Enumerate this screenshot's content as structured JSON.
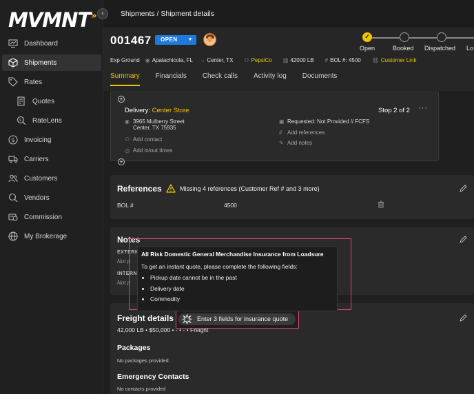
{
  "app": {
    "logo": "MVMNT",
    "logo_accent": "»",
    "collapse_icon": "‹"
  },
  "sidebar": {
    "items": [
      {
        "label": "Dashboard",
        "icon": "dashboard-icon",
        "active": false,
        "sub": false
      },
      {
        "label": "Shipments",
        "icon": "box-icon",
        "active": true,
        "sub": false
      },
      {
        "label": "Rates",
        "icon": "tag-icon",
        "active": false,
        "sub": false
      },
      {
        "label": "Quotes",
        "icon": "quotes-icon",
        "active": false,
        "sub": true
      },
      {
        "label": "RateLens",
        "icon": "ratelens-icon",
        "active": false,
        "sub": true
      },
      {
        "label": "Invoicing",
        "icon": "dollar-icon",
        "active": false,
        "sub": false
      },
      {
        "label": "Carriers",
        "icon": "truck-icon",
        "active": false,
        "sub": false
      },
      {
        "label": "Customers",
        "icon": "users-icon",
        "active": false,
        "sub": false
      },
      {
        "label": "Vendors",
        "icon": "vendor-icon",
        "active": false,
        "sub": false
      },
      {
        "label": "Commission",
        "icon": "commission-icon",
        "active": false,
        "sub": false
      },
      {
        "label": "My Brokerage",
        "icon": "globe-icon",
        "active": false,
        "sub": false
      }
    ]
  },
  "breadcrumb": "Shipments / Shipment details",
  "header": {
    "order_id": "001467",
    "status": "OPEN",
    "meta": {
      "mode": "Exp Ground",
      "origin": "Apalachicola, FL",
      "arrow": "→",
      "destination": "Center, TX",
      "customer": "PepsiCo",
      "weight": "42000 LB",
      "bol": "BOL #: 4500",
      "customer_link": "Customer Link"
    },
    "tabs": [
      {
        "label": "Summary",
        "active": true
      },
      {
        "label": "Financials",
        "active": false
      },
      {
        "label": "Check calls",
        "active": false
      },
      {
        "label": "Activity log",
        "active": false
      },
      {
        "label": "Documents",
        "active": false
      }
    ],
    "steps": [
      {
        "label": "Open",
        "done": true
      },
      {
        "label": "Booked",
        "done": false
      },
      {
        "label": "Dispatched",
        "done": false
      },
      {
        "label": "Lo",
        "done": false
      }
    ],
    "step_check": "✓"
  },
  "delivery": {
    "title_prefix": "Delivery: ",
    "title_location": "Center Store",
    "stop": "Stop 2 of 2",
    "more": "···",
    "address_line1": "3965 Mulberry Street",
    "address_line2": "Center, TX 75935",
    "add_contact": "Add contact",
    "add_times": "Add in/out times",
    "requested": "Requested: Not Provided // FCFS",
    "add_references": "Add references",
    "add_notes": "Add notes",
    "plus": "+"
  },
  "references": {
    "title": "References",
    "warning": "Missing 4 references (Customer Ref # and 3 more)",
    "bol_label": "BOL #",
    "bol_value": "4500"
  },
  "notes": {
    "title": "Notes",
    "external_label": "EXTERN",
    "external_value": "Not p",
    "internal_label": "INTERN",
    "internal_value": "Not p"
  },
  "tooltip": {
    "title": "All Risk Domestic General Merchandise Insurance from Loadsure",
    "subtitle": "To get an instant quote, please complete the following fields:",
    "items": [
      "Pickup date cannot be in the past",
      "Delivery date",
      "Commodity"
    ]
  },
  "freight": {
    "title": "Freight details",
    "summary": "42,000 LB • $50,000 • - • - • Freight",
    "insurance_button": "Enter 3 fields for insurance quote",
    "packages_title": "Packages",
    "packages_value": "No packages provided.",
    "emergency_title": "Emergency Contacts",
    "emergency_value": "No contacts provided"
  },
  "colors": {
    "accent": "#f2c400",
    "status_blue": "#1f7ae0",
    "highlight": "#d9488a"
  }
}
